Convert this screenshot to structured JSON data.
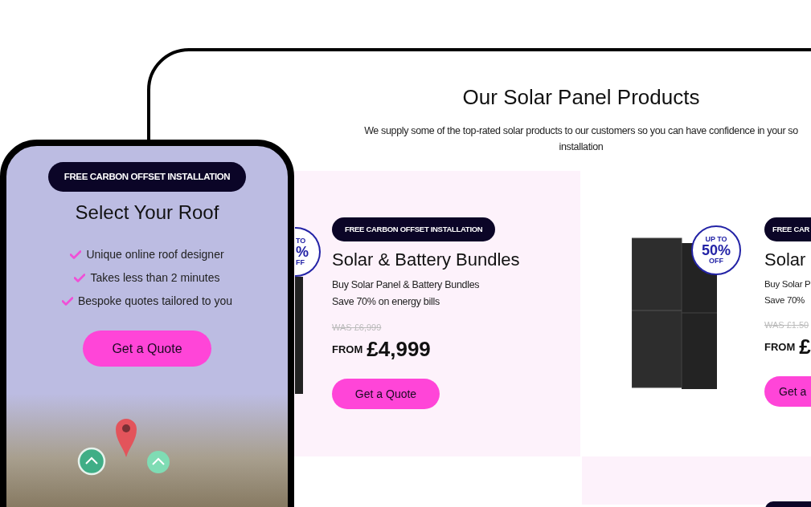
{
  "desktop": {
    "heading": "Our Solar Panel Products",
    "subtitle_lines": [
      "We supply some of the top-rated solar products to our customers so you can have confidence in your so",
      "installation"
    ],
    "products": [
      {
        "discount_badge": [
          "TO",
          "%",
          "FF"
        ],
        "tag": "FREE CARBON OFFSET INSTALLATION",
        "title": "Solar & Battery Bundles",
        "lines": [
          "Buy Solar Panel & Battery Bundles",
          "Save 70% on energy bills"
        ],
        "was_price": "WAS £6,999",
        "from_label": "FROM",
        "price": "£4,999",
        "button": "Get a Quote"
      },
      {
        "discount_badge": [
          "UP TO",
          "50%",
          "OFF"
        ],
        "tag": "FREE CAR",
        "title": "Solar",
        "lines": [
          "Buy Solar P",
          "Save 70%"
        ],
        "was_price": "WAS £1.50",
        "from_label": "FROM",
        "price": "£",
        "button": "Get a"
      }
    ]
  },
  "phone": {
    "tag": "FREE CARBON OFFSET INSTALLATION",
    "title": "Select Your Roof",
    "features": [
      "Unique online roof designer",
      "Takes less than 2 minutes",
      "Bespoke quotes tailored to you"
    ],
    "button": "Get a Quote"
  }
}
